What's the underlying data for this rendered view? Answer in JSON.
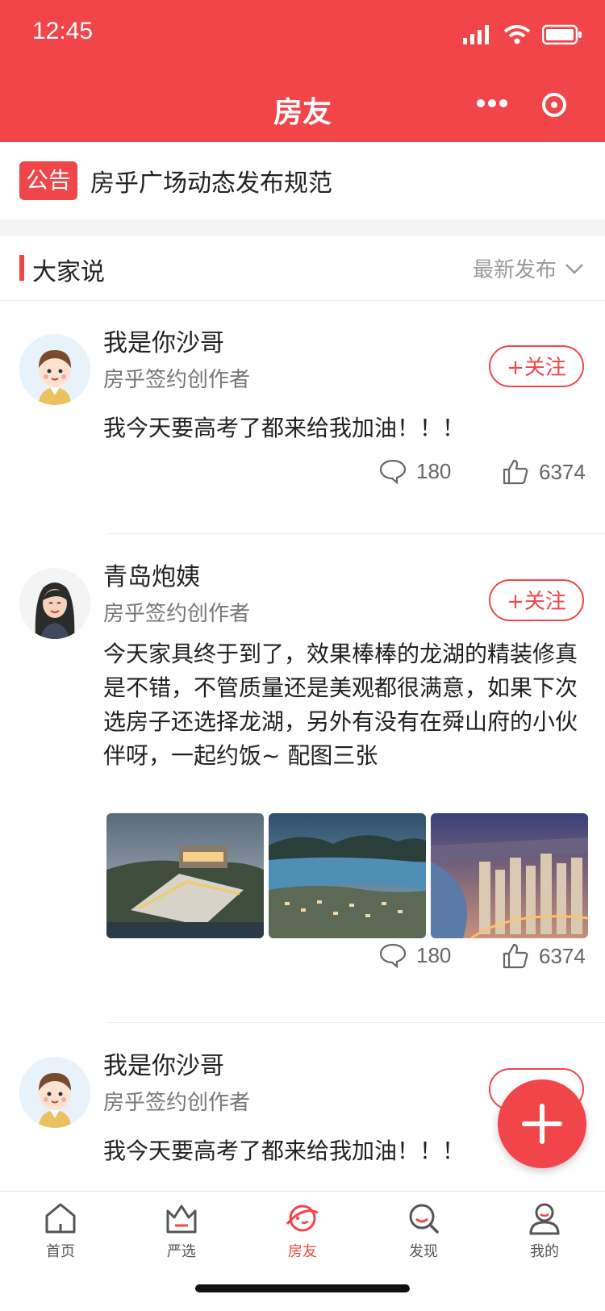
{
  "status": {
    "time": "12:45"
  },
  "nav": {
    "title": "房友"
  },
  "notice": {
    "tag": "公告",
    "text": "房乎广场动态发布规范"
  },
  "section": {
    "title": "大家说",
    "sort_label": "最新发布"
  },
  "posts": [
    {
      "user": "我是你沙哥",
      "subtitle": "房乎签约创作者",
      "follow_label": "+关注",
      "content": "我今天要高考了都来给我加油！！！",
      "comments": "180",
      "likes": "6374"
    },
    {
      "user": "青岛炮姨",
      "subtitle": "房乎签约创作者",
      "follow_label": "+关注",
      "content": "今天家具终于到了，效果棒棒的龙湖的精装修真是不错，不管质量还是美观都很满意，如果下次选房子还选择龙湖，另外有没有在舜山府的小伙伴呀，一起约饭~ 配图三张",
      "comments": "180",
      "likes": "6374"
    },
    {
      "user": "我是你沙哥",
      "subtitle": "房乎签约创作者",
      "content": "我今天要高考了都来给我加油！！！"
    }
  ],
  "tabs": [
    {
      "label": "首页",
      "icon": "home-icon"
    },
    {
      "label": "严选",
      "icon": "crown-icon"
    },
    {
      "label": "房友",
      "icon": "planet-icon",
      "active": true
    },
    {
      "label": "发现",
      "icon": "search-icon"
    },
    {
      "label": "我的",
      "icon": "user-icon"
    }
  ],
  "colors": {
    "accent": "#f24549"
  }
}
